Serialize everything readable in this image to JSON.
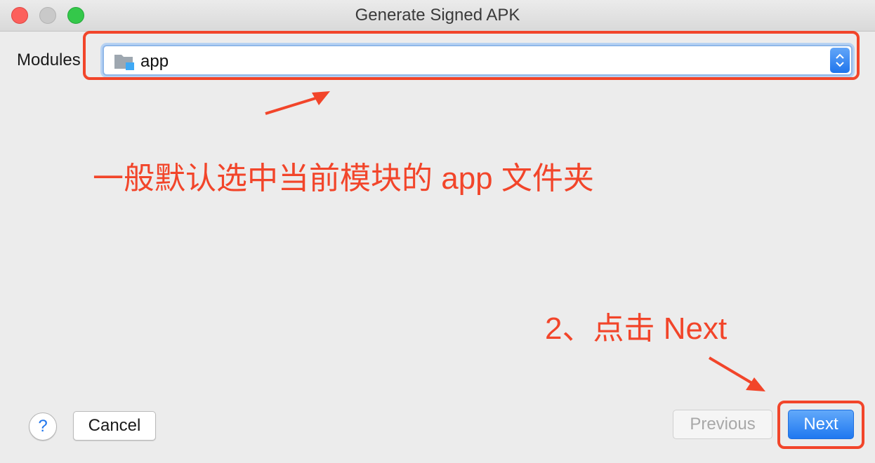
{
  "window": {
    "title": "Generate Signed APK"
  },
  "module_row": {
    "label": "Modules",
    "selected_value": "app",
    "icon": "folder-module-icon"
  },
  "annotations": {
    "main_note": "一般默认选中当前模块的 app 文件夹",
    "step_note": "2、点击 Next",
    "color": "#f2452a"
  },
  "footer": {
    "help_label": "?",
    "cancel_label": "Cancel",
    "previous_label": "Previous",
    "next_label": "Next"
  },
  "colors": {
    "accent": "#1f75ec",
    "close": "#fc605c",
    "maximize": "#34c84a"
  }
}
